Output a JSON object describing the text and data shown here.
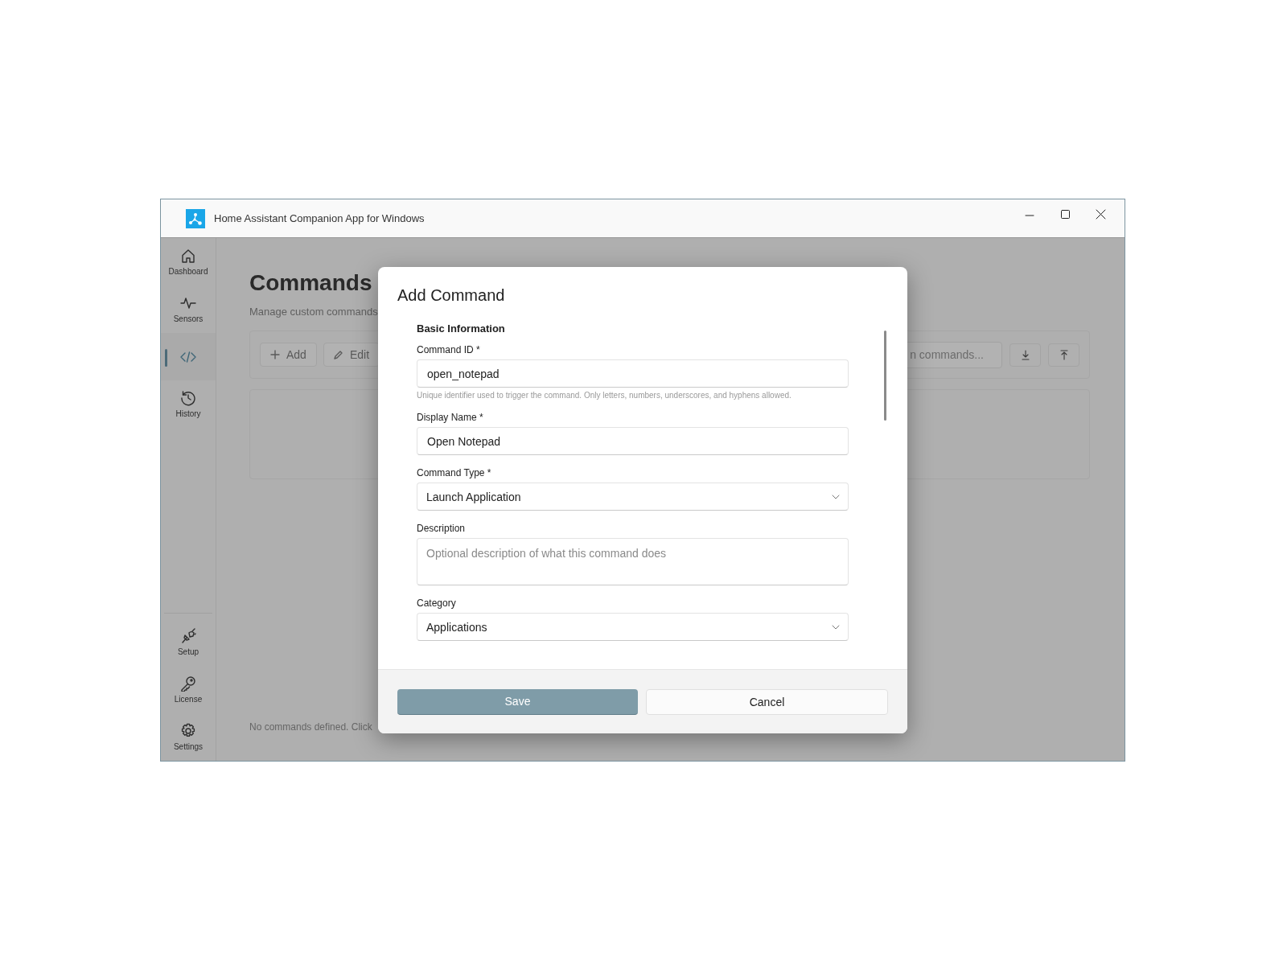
{
  "window": {
    "title": "Home Assistant Companion App for Windows"
  },
  "sidebar": {
    "top_items": [
      {
        "label": "Dashboard",
        "selected": false
      },
      {
        "label": "Sensors",
        "selected": false
      },
      {
        "selected": true
      },
      {
        "label": "History",
        "selected": false
      }
    ],
    "bottom_items": [
      {
        "label": "Setup",
        "selected": false
      },
      {
        "label": "License",
        "selected": false
      },
      {
        "label": "Settings",
        "selected": false
      }
    ]
  },
  "page": {
    "title": "Commands",
    "subtitle": "Manage custom commands",
    "toolbar": {
      "buttons": [
        {
          "label": "Add"
        },
        {
          "label": "Edit"
        }
      ],
      "search": {
        "placeholder": "n commands..."
      }
    },
    "empty_message": "No commands defined. Click"
  },
  "dialog": {
    "title": "Add Command",
    "section": "Basic Information",
    "fields": [
      {
        "kind": "text",
        "label": "Command ID *",
        "value": "open_notepad",
        "hint": "Unique identifier used to trigger the command. Only letters, numbers, underscores, and hyphens allowed."
      },
      {
        "kind": "text",
        "label": "Display Name *",
        "value": "Open Notepad"
      },
      {
        "kind": "select",
        "label": "Command Type *",
        "value": "Launch Application"
      },
      {
        "kind": "textarea",
        "label": "Description",
        "placeholder": "Optional description of what this command does"
      },
      {
        "kind": "select",
        "label": "Category",
        "value": "Applications"
      }
    ],
    "buttons": [
      {
        "kind": "primary",
        "label": "Save"
      },
      {
        "kind": "secondary",
        "label": "Cancel"
      }
    ]
  }
}
